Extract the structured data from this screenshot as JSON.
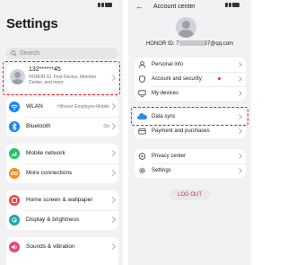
{
  "left_screen": {
    "title": "Settings",
    "search": {
      "placeholder": "Search"
    },
    "account": {
      "name": "132******45",
      "subtitle": "HONOR ID, Find Device, Member Center, and more"
    },
    "groups": [
      [
        {
          "label": "WLAN",
          "value": "Hihonor-Employee-Mobile",
          "icon": "wifi-icon",
          "color": "#1b86f5"
        },
        {
          "label": "Bluetooth",
          "value": "On",
          "icon": "bluetooth-icon",
          "color": "#1b86f5"
        }
      ],
      [
        {
          "label": "Mobile network",
          "value": "",
          "icon": "mobile-network-icon",
          "color": "#27c163"
        },
        {
          "label": "More connections",
          "value": "",
          "icon": "more-connections-icon",
          "color": "#f58a1f"
        }
      ],
      [
        {
          "label": "Home screen & wallpaper",
          "value": "",
          "icon": "home-screen-icon",
          "color": "#ef4a4a"
        },
        {
          "label": "Display & brightness",
          "value": "",
          "icon": "display-icon",
          "color": "#1aa9b4"
        }
      ],
      [
        {
          "label": "Sounds & vibration",
          "value": "",
          "icon": "sound-icon",
          "color": "#e7487a"
        }
      ]
    ]
  },
  "right_screen": {
    "title": "Account center",
    "honor_id_prefix": "HONOR ID: 7",
    "honor_id_suffix": "37@qq.com",
    "groups": [
      [
        {
          "label": "Personal info",
          "icon": "person-icon"
        },
        {
          "label": "Account and security",
          "icon": "shield-icon",
          "badge": true
        },
        {
          "label": "My devices",
          "icon": "devices-icon"
        }
      ],
      [
        {
          "label": "Data sync",
          "icon": "cloud-icon"
        },
        {
          "label": "Payment and purchases",
          "icon": "wallet-icon"
        }
      ],
      [
        {
          "label": "Privacy center",
          "icon": "privacy-icon"
        },
        {
          "label": "Settings",
          "icon": "gear-icon"
        }
      ]
    ],
    "logout_label": "LOG OUT"
  },
  "highlight_color": "#d9242b"
}
